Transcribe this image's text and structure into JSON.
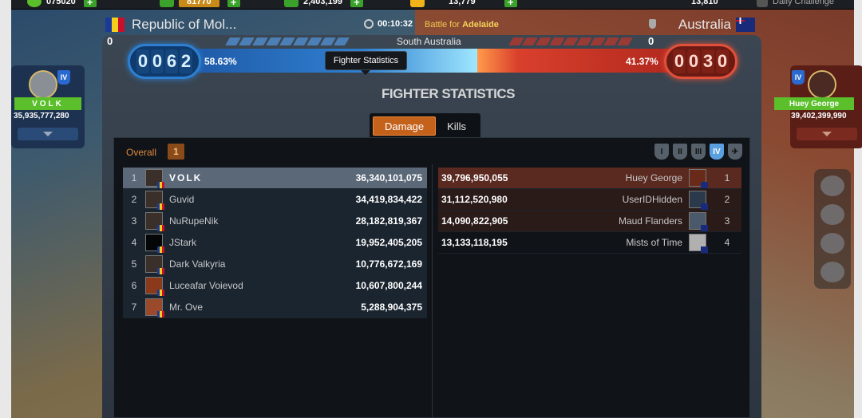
{
  "topbar": {
    "resources": [
      {
        "value": "075020",
        "color": "#5abf2a"
      },
      {
        "value": "81770",
        "color": "#e0a020"
      },
      {
        "value": "2,403,199",
        "color": "#3aa22a"
      },
      {
        "value": "13,779",
        "color": "#f2b21a"
      }
    ],
    "right_value": "13,810",
    "daily_challenge": "Daily Challenge"
  },
  "header": {
    "country_left": "Republic of Mol...",
    "country_right": "Australia",
    "timer": "00:10:32",
    "battle_prefix": "Battle for ",
    "battle_target": "Adelaide"
  },
  "score": {
    "sub_left": "0",
    "sub_right": "0",
    "region": "South Australia",
    "left_digits": [
      "0",
      "0",
      "6",
      "2"
    ],
    "right_digits": [
      "0",
      "0",
      "3",
      "0"
    ],
    "left_pct": "58.63%",
    "right_pct": "41.37%",
    "left_fraction": 0.5863,
    "tooltip": "Fighter Statistics"
  },
  "stats": {
    "title": "FIGHTER STATISTICS",
    "tabs": [
      {
        "label": "Damage",
        "active": true
      },
      {
        "label": "Kills",
        "active": false
      }
    ],
    "overall_label": "Overall",
    "overall_rank": "1",
    "tiers": [
      "I",
      "II",
      "III",
      "IV",
      "✈"
    ],
    "left_rows": [
      {
        "rank": "1",
        "name": "VOLK",
        "value": "36,340,101,075"
      },
      {
        "rank": "2",
        "name": "Guvid",
        "value": "34,419,834,422"
      },
      {
        "rank": "3",
        "name": "NuRupeNik",
        "value": "28,182,819,367"
      },
      {
        "rank": "4",
        "name": "JStark",
        "value": "19,952,405,205"
      },
      {
        "rank": "5",
        "name": "Dark Valkyria",
        "value": "10,776,672,169"
      },
      {
        "rank": "6",
        "name": "Luceafar Voievod",
        "value": "10,607,800,244"
      },
      {
        "rank": "7",
        "name": "Mr. Ove",
        "value": "5,288,904,375"
      }
    ],
    "right_rows": [
      {
        "rank": "1",
        "name": "Huey George",
        "value": "39,796,950,055"
      },
      {
        "rank": "2",
        "name": "UserIDHidden",
        "value": "31,112,520,980"
      },
      {
        "rank": "3",
        "name": "Maud Flanders",
        "value": "14,090,822,905"
      },
      {
        "rank": "4",
        "name": "Mists of Time",
        "value": "13,133,118,195"
      }
    ]
  },
  "players": {
    "left": {
      "name": "VOLK",
      "level": "IV",
      "amount": "35,935,777,280"
    },
    "right": {
      "name": "Huey George",
      "level": "IV",
      "amount": "39,402,399,990"
    }
  },
  "colors": {
    "blue_side": "#2f80d0",
    "red_side": "#d9402c",
    "accent": "#c4621c"
  }
}
